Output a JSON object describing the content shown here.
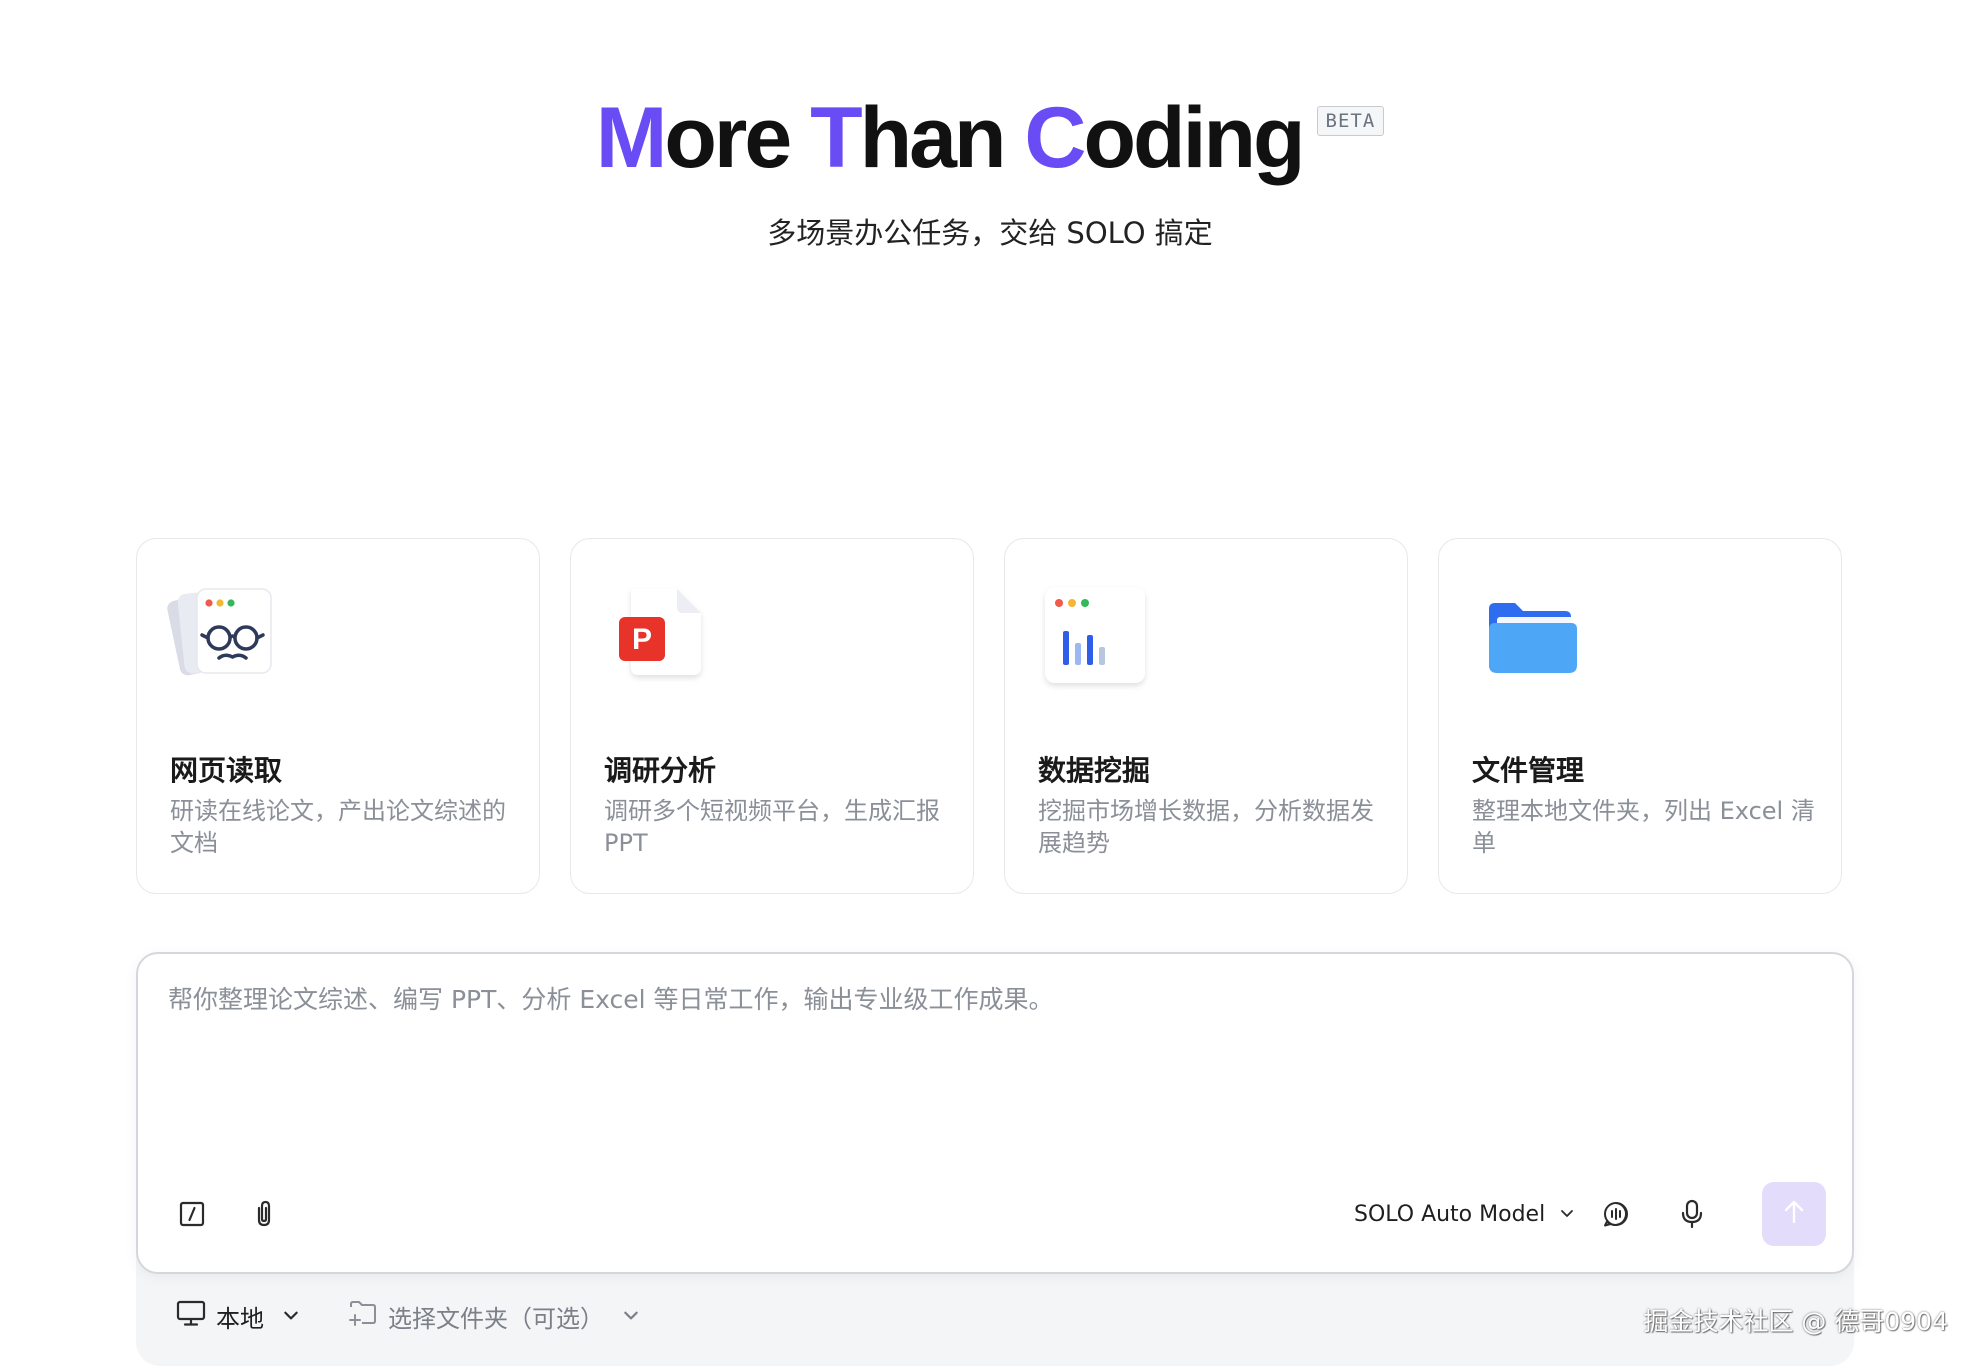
{
  "hero": {
    "title_parts": {
      "m": "M",
      "ore": "ore ",
      "t": "T",
      "han": "han ",
      "c": "C",
      "oding": "oding"
    },
    "beta": "BETA",
    "subtitle": "多场景办公任务，交给 SOLO 搞定"
  },
  "colors": {
    "accent": "#6a4cf5",
    "send_button_bg": "#e3dcfb"
  },
  "cards": [
    {
      "title": "网页读取",
      "desc": "研读在线论文，产出论文综述的文档",
      "icon": "glasses-browser-icon"
    },
    {
      "title": "调研分析",
      "desc": "调研多个短视频平台，生成汇报 PPT",
      "icon": "powerpoint-file-icon"
    },
    {
      "title": "数据挖掘",
      "desc": "挖掘市场增长数据，分析数据发展趋势",
      "icon": "bar-chart-window-icon"
    },
    {
      "title": "文件管理",
      "desc": "整理本地文件夹，列出 Excel 清单",
      "icon": "folder-icon"
    }
  ],
  "composer": {
    "placeholder": "帮你整理论文综述、编写 PPT、分析 Excel 等日常工作，输出专业级工作成果。",
    "value": "",
    "model": "SOLO Auto Model"
  },
  "bottom": {
    "env_label": "本地",
    "folder_label": "选择文件夹（可选）"
  },
  "watermark": "掘金技术社区 @ 德哥0904"
}
